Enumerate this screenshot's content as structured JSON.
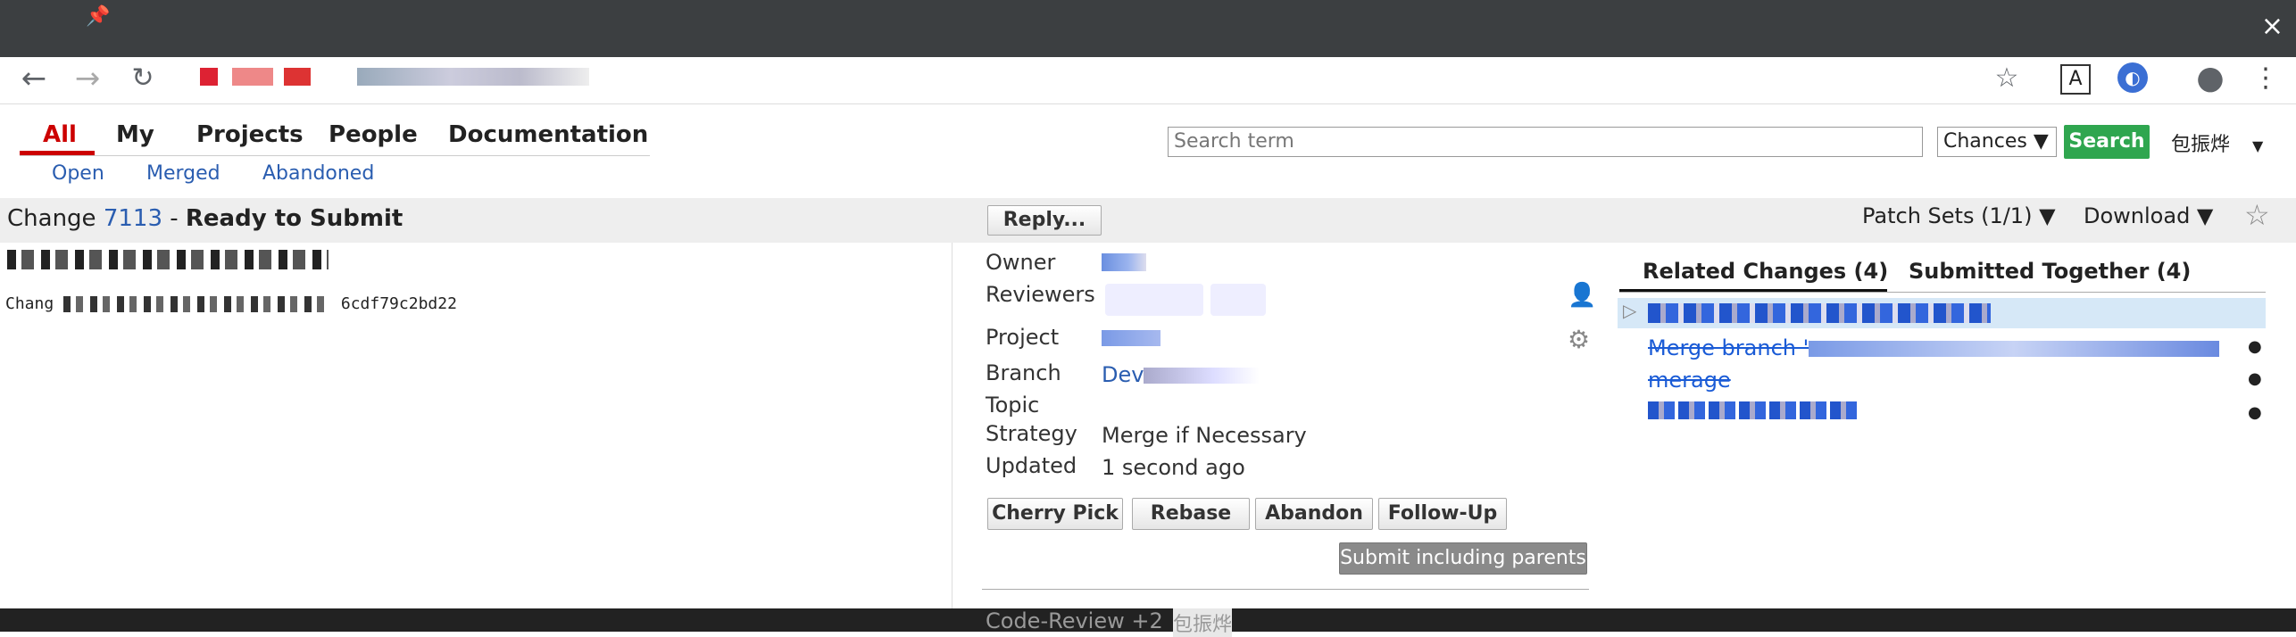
{
  "window": {
    "close_glyph": "×"
  },
  "browser": {
    "back_icon": "arrow-left",
    "forward_icon": "arrow-right",
    "reload_icon": "reload",
    "star_icon": "star",
    "ext_icon_1": "A",
    "profile_icon": "account-circle",
    "menu_icon": "kebab"
  },
  "menu": {
    "items": [
      "All",
      "My",
      "Projects",
      "People",
      "Documentation"
    ],
    "sub_items": [
      "Open",
      "Merged",
      "Abandoned"
    ]
  },
  "search": {
    "placeholder": "Search term",
    "scope_value": "Chances",
    "button_label": "Search"
  },
  "user": {
    "name": "包振烨"
  },
  "change": {
    "label": "Change",
    "number": "7113",
    "separator": " - ",
    "status": "Ready to Submit",
    "reply_label": "Reply...",
    "patch_sets_label": "Patch Sets (1/1) ▼",
    "download_label": "Download ▼",
    "change_id_prefix": "Chang",
    "change_id_suffix": "6cdf79",
    "change_id_tail": "c2bd22"
  },
  "info": {
    "owner_label": "Owner",
    "reviewers_label": "Reviewers",
    "project_label": "Project",
    "branch_label": "Branch",
    "branch_value": "Dev",
    "topic_label": "Topic",
    "strategy_label": "Strategy",
    "strategy_value": "Merge if Necessary",
    "updated_label": "Updated",
    "updated_value": "1 second ago"
  },
  "actions": {
    "cherry_pick": "Cherry Pick",
    "rebase": "Rebase",
    "abandon": "Abandon",
    "follow_up": "Follow-Up",
    "submit": "Submit including parents"
  },
  "related": {
    "tab_related": "Related Changes (4)",
    "tab_submitted": "Submitted Together (4)",
    "items": [
      "Merge branch '",
      "merage"
    ]
  },
  "footer": {
    "code_review": "Code-Review +2",
    "reviewer": "包振烨"
  },
  "colors": {
    "accent_green": "#2fa64f",
    "link_blue": "#2a5db0",
    "active_red": "#c00"
  }
}
